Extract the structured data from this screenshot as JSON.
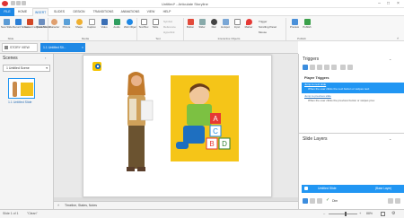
{
  "app": {
    "title": "Untitled* - Articulate Storyline"
  },
  "ribbon_tabs": [
    "FILE",
    "HOME",
    "INSERT",
    "SLIDES",
    "DESIGN",
    "TRANSITIONS",
    "ANIMATIONS",
    "VIEW",
    "HELP"
  ],
  "ribbon": {
    "groups": [
      {
        "label": "Slide",
        "buttons": [
          "New Slide",
          "Slide Layers"
        ]
      },
      {
        "label": "Media",
        "buttons": [
          "Record Screen",
          "Convert to PowerPoint",
          "Quick Screen",
          "Character",
          "Picture",
          "Shape",
          "Caption",
          "Video",
          "Audio",
          "Web Object"
        ]
      },
      {
        "label": "Text",
        "buttons": [
          "Text Box",
          "Table"
        ]
      },
      {
        "label": "Interactive Objects",
        "buttons": [
          "Button",
          "Slider",
          "Dial",
          "Hotspot",
          "Input",
          "Marker"
        ]
      },
      {
        "label": "Publish",
        "buttons": [
          "Preview",
          "Publish"
        ]
      }
    ],
    "text_options": [
      "Symbol",
      "Reference",
      "Hyperlink"
    ],
    "trigger_options": [
      "Trigger",
      "Scrolling Panel",
      "Mouse"
    ]
  },
  "tabs": {
    "story_view": "STORY VIEW",
    "slide_tab": "1.1 Untitled Sli..."
  },
  "scenes": {
    "title": "Scenes",
    "dropdown": "1 Untitled Scene",
    "slides": [
      {
        "label": "1.1 Untitled Slide"
      }
    ]
  },
  "timeline_label": "Timeline, States, Notes",
  "triggers": {
    "title": "Triggers",
    "section": "Player Triggers",
    "items": [
      {
        "action": "Jump to next slide",
        "condition": "When the user clicks the next button or swipes next"
      },
      {
        "action": "Jump to previous slide",
        "condition": "When the user clicks the previous button or swipes prev"
      }
    ]
  },
  "slide_layers": {
    "title": "Slide Layers",
    "base": {
      "name": "Untitled Slide",
      "tag": "(Base Layer)"
    },
    "dim_label": "Dim"
  },
  "status": {
    "slide": "Slide 1 of 1",
    "theme": "\"Clean\"",
    "zoom": "88%"
  },
  "colors": {
    "accent": "#1e88e5",
    "selected": "#2196f3"
  }
}
